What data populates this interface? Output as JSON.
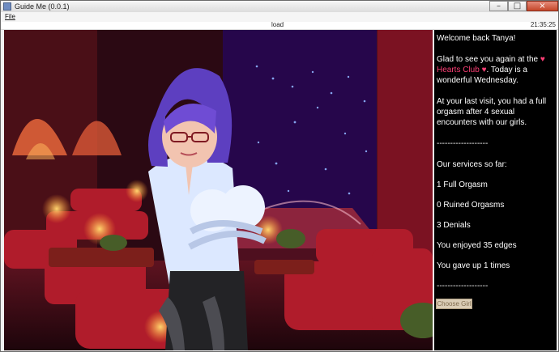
{
  "window": {
    "title": "Guide Me (0.0.1)",
    "buttons": {
      "minimize": "–",
      "maximize": "□",
      "close": "×"
    }
  },
  "menu": {
    "file": "File"
  },
  "status": {
    "text": "load",
    "clock": "21:35:25"
  },
  "panel": {
    "greeting": "Welcome back Tanya!",
    "intro_before": "Glad to see you again at the",
    "club_name": "♥ Hearts Club ♥",
    "intro_after": ". Today is a wonderful Wednesday.",
    "last_visit": "At your last visit, you had a full orgasm after 4 sexual encounters with our girls.",
    "divider": "-------------------",
    "services_heading": "Our services so far:",
    "stats": [
      "1 Full Orgasm",
      "0 Ruined Orgasms",
      "3 Denials",
      "You enjoyed 35 edges",
      "You gave up 1 times"
    ],
    "choose_girl_label": "Choose Girl"
  },
  "icons": {
    "app": "app-window-icon",
    "minimize": "minimize-icon",
    "maximize": "maximize-icon",
    "close": "close-icon"
  },
  "colors": {
    "accent": "#ff3f76",
    "panel_bg": "#000000",
    "close": "#c44729"
  }
}
